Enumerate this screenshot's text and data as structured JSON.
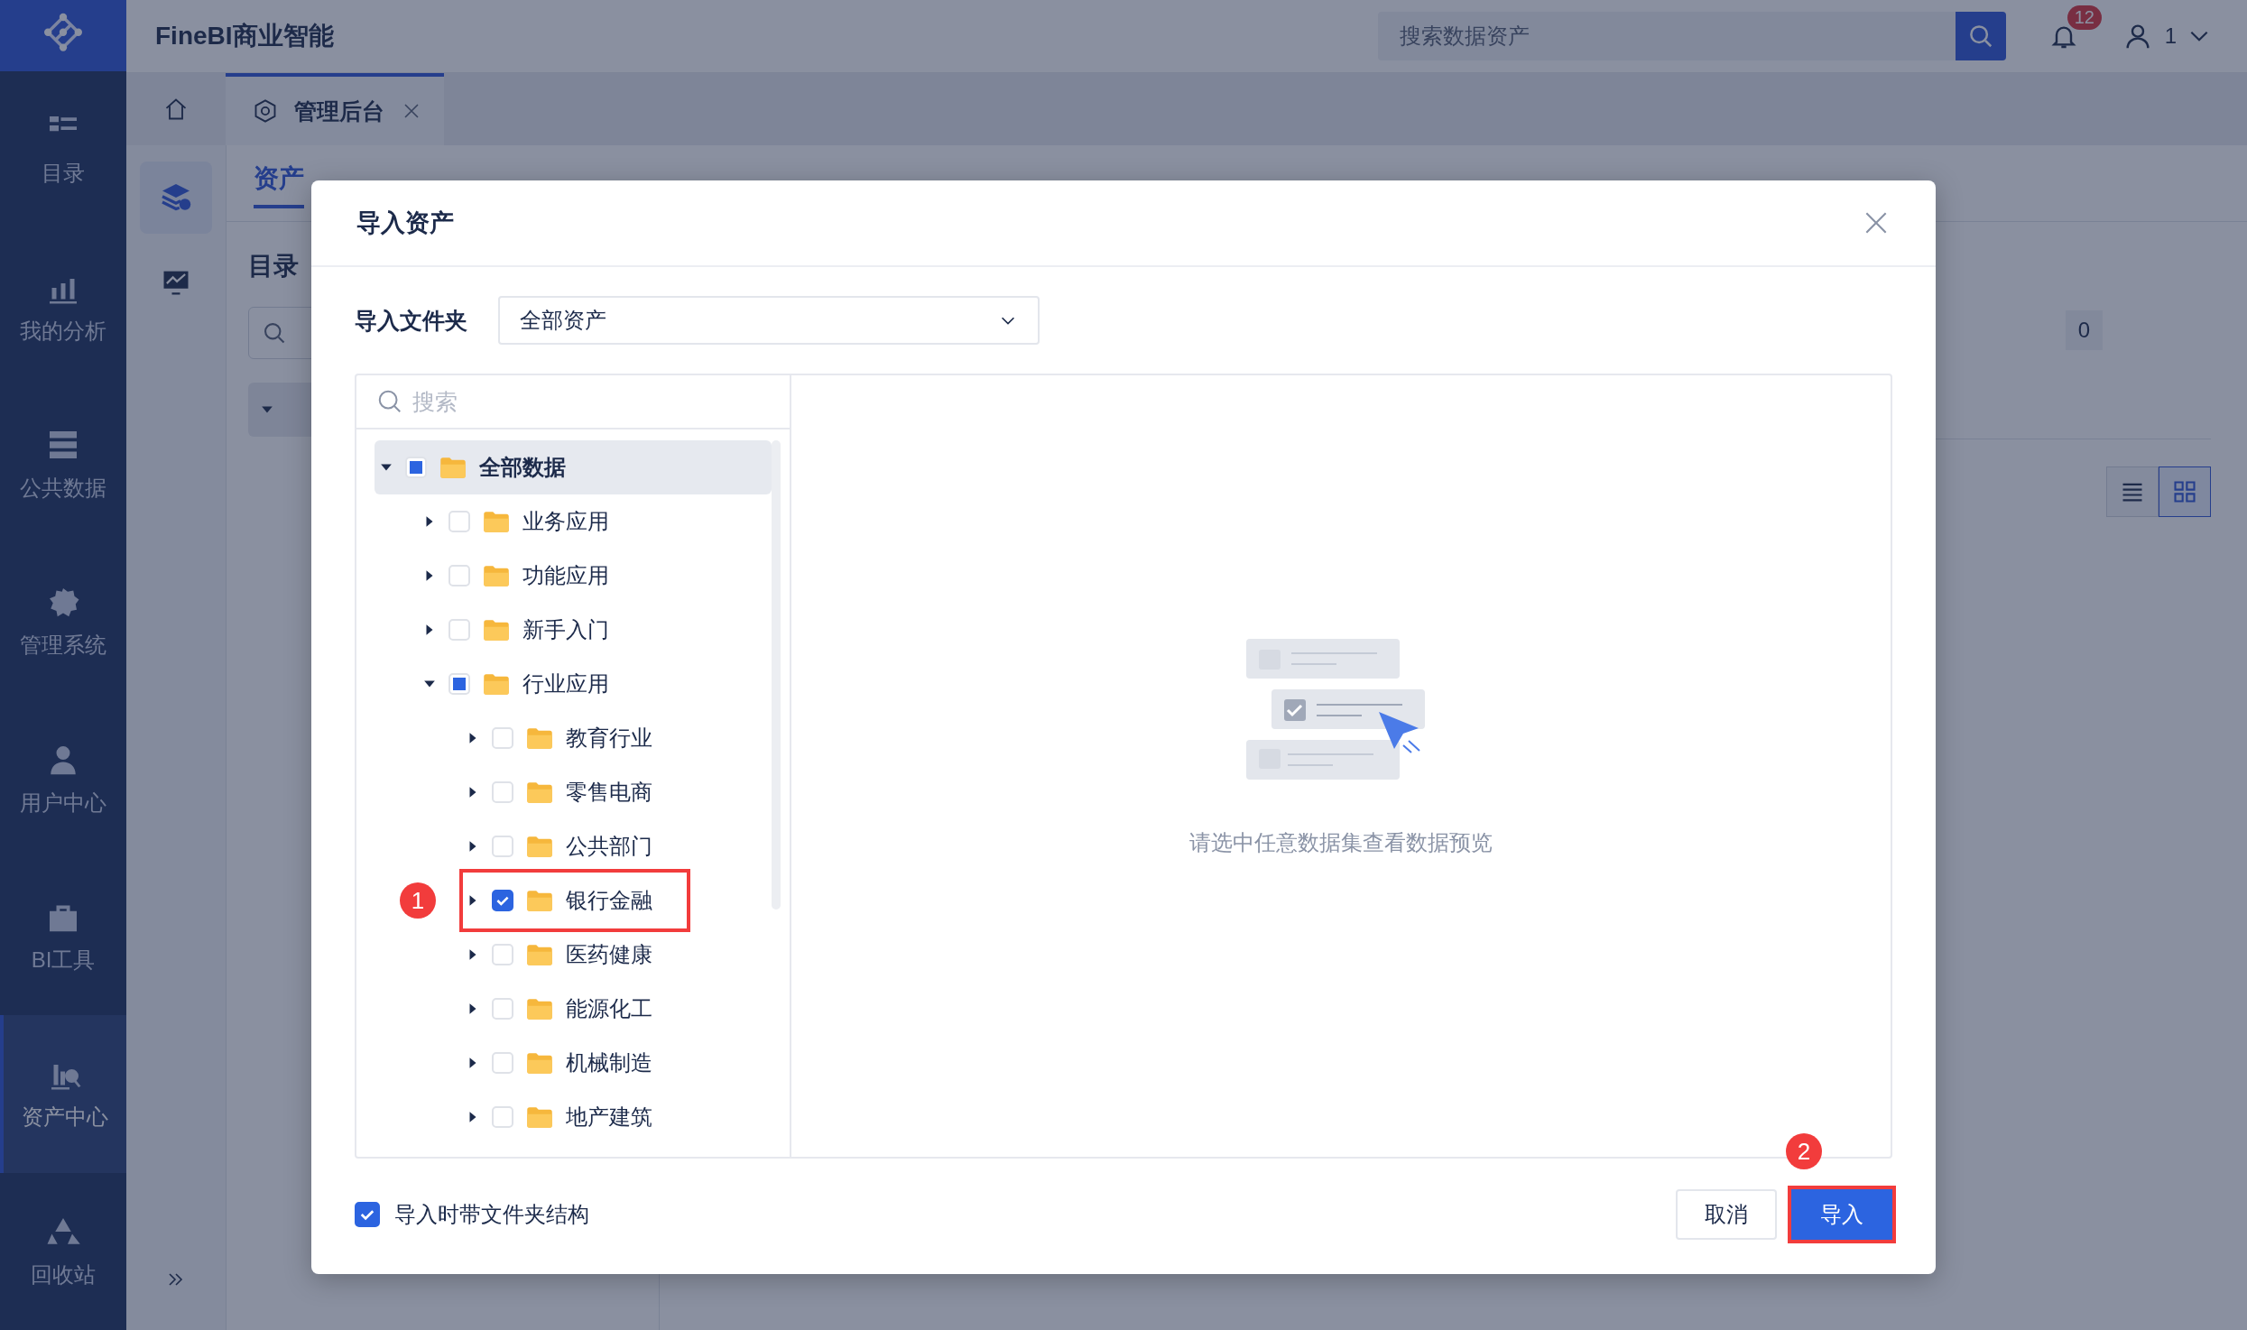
{
  "app": {
    "title": "FineBI商业智能",
    "search": {
      "placeholder": "搜索数据资产"
    },
    "notifications": "12",
    "user": "1"
  },
  "nav": [
    {
      "label": "目录",
      "selected": false
    },
    {
      "label": "我的分析",
      "selected": false
    },
    {
      "label": "公共数据",
      "selected": false
    },
    {
      "label": "管理系统",
      "selected": false
    },
    {
      "label": "用户中心",
      "selected": false
    },
    {
      "label": "BI工具",
      "selected": false
    },
    {
      "label": "资产中心",
      "selected": true
    },
    {
      "label": "回收站",
      "selected": false
    }
  ],
  "tabs": [
    {
      "label": "管理后台",
      "selected": true
    }
  ],
  "page": {
    "tabs": [
      {
        "label": "资产",
        "selected": true
      }
    ],
    "section_title": "目录",
    "count": "0"
  },
  "view_toggle": [
    {
      "kind": "list",
      "selected": false
    },
    {
      "kind": "grid",
      "selected": true
    }
  ],
  "dialog": {
    "title": "导入资产",
    "folder_label": "导入文件夹",
    "folder_value": "全部资产",
    "search": {
      "placeholder": "搜索"
    },
    "tree": [
      {
        "label": "全部数据",
        "expanded": true,
        "checked": false,
        "partial": true,
        "selected": true,
        "children": [
          {
            "label": "业务应用",
            "expanded": false,
            "checked": false,
            "partial": false,
            "selected": false
          },
          {
            "label": "功能应用",
            "expanded": false,
            "checked": false,
            "partial": false,
            "selected": false
          },
          {
            "label": "新手入门",
            "expanded": false,
            "checked": false,
            "partial": false,
            "selected": false
          },
          {
            "label": "行业应用",
            "expanded": true,
            "checked": false,
            "partial": true,
            "selected": false,
            "children": [
              {
                "label": "教育行业",
                "expanded": false,
                "checked": false,
                "partial": false,
                "selected": false
              },
              {
                "label": "零售电商",
                "expanded": false,
                "checked": false,
                "partial": false,
                "selected": false
              },
              {
                "label": "公共部门",
                "expanded": false,
                "checked": false,
                "partial": false,
                "selected": false
              },
              {
                "label": "银行金融",
                "expanded": false,
                "checked": true,
                "selected": false,
                "annotation": "1"
              },
              {
                "label": "医药健康",
                "expanded": false,
                "checked": false,
                "partial": false,
                "selected": false
              },
              {
                "label": "能源化工",
                "expanded": false,
                "checked": false,
                "partial": false,
                "selected": false
              },
              {
                "label": "机械制造",
                "expanded": false,
                "checked": false,
                "partial": false,
                "selected": false
              },
              {
                "label": "地产建筑",
                "expanded": false,
                "checked": false,
                "partial": false,
                "selected": false
              }
            ]
          }
        ]
      }
    ],
    "empty_text": "请选中任意数据集查看数据预览",
    "keep_structure": {
      "label": "导入时带文件夹结构",
      "checked": true
    },
    "buttons": [
      {
        "label": "取消",
        "kind": "secondary"
      },
      {
        "label": "导入",
        "kind": "primary",
        "annotation": "2"
      }
    ]
  }
}
